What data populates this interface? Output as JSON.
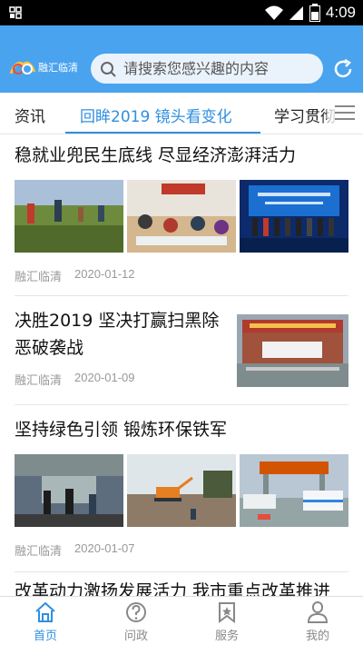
{
  "status_bar": {
    "time": "4:09"
  },
  "header": {
    "logo_text": "融汇临清",
    "search": {
      "placeholder": "请搜索您感兴趣的内容"
    }
  },
  "tabs": [
    {
      "label": "资讯"
    },
    {
      "label": "回眸2019 镜头看变化"
    },
    {
      "label": "学习贯彻"
    }
  ],
  "news": [
    {
      "title": "稳就业兜民生底线 尽显经济澎湃活力",
      "source": "融汇临清",
      "date": "2020-01-12"
    },
    {
      "title": "决胜2019 坚决打赢扫黑除恶破袭战",
      "source": "融汇临清",
      "date": "2020-01-09"
    },
    {
      "title": "坚持绿色引领 锻炼环保铁军",
      "source": "融汇临清",
      "date": "2020-01-07"
    },
    {
      "title": "改革动力激扬发展活力 我市重点改革推进"
    }
  ],
  "bottom_nav": [
    {
      "label": "首页",
      "icon": "home-icon",
      "active": true
    },
    {
      "label": "问政",
      "icon": "question-icon",
      "active": false
    },
    {
      "label": "服务",
      "icon": "bookmark-icon",
      "active": false
    },
    {
      "label": "我的",
      "icon": "user-icon",
      "active": false
    }
  ],
  "colors": {
    "brand": "#4aa3ef",
    "accent": "#2f8fe0"
  }
}
